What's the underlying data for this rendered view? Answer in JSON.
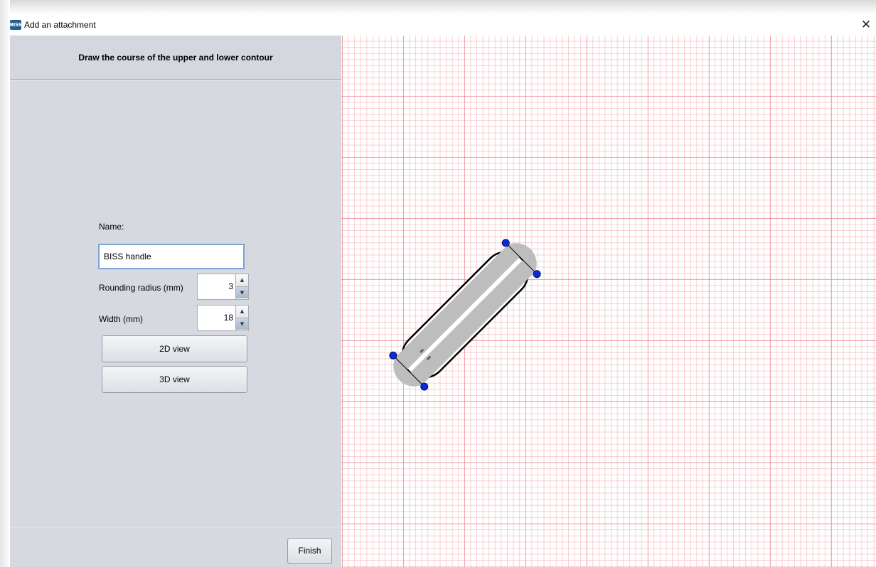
{
  "window": {
    "icon_text": "BISS",
    "title": "Add an attachment",
    "close_symbol": "✕"
  },
  "panel": {
    "header": "Draw the course of the upper and lower contour",
    "name_label": "Name:",
    "name_value": "BISS handle",
    "rounding_label": "Rounding radius (mm)",
    "rounding_value": "3",
    "width_label": "Width (mm)",
    "width_value": "18",
    "view2d_label": "2D view",
    "view3d_label": "3D view",
    "finish_label": "Finish"
  },
  "icons": {
    "spinner_up": "▲",
    "spinner_down": "▼"
  },
  "colors": {
    "panel_bg": "#d6d9e0",
    "grid_line": "#e87882",
    "handle_fill": "#bdbdbd",
    "control_point": "#0b2bd6",
    "input_focus_border": "#7aa5d4"
  }
}
